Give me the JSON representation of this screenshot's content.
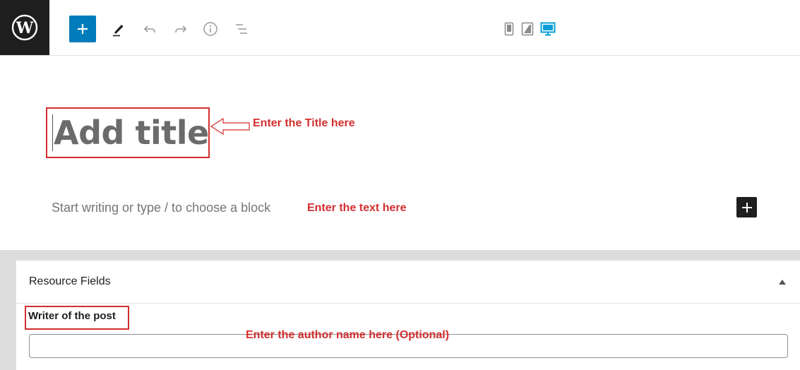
{
  "toolbar": {
    "logo_icon": "wordpress-icon",
    "add_block_icon": "plus-icon",
    "tools_icon": "pencil-icon",
    "undo_icon": "undo-icon",
    "redo_icon": "redo-icon",
    "info_icon": "info-icon",
    "outline_icon": "list-view-icon",
    "preview_devices": [
      "mobile-icon",
      "tablet-icon",
      "desktop-icon"
    ],
    "active_device": "desktop",
    "accent_color": "#007cba"
  },
  "editor": {
    "title_placeholder": "Add title",
    "body_placeholder": "Start writing or type / to choose a block",
    "inline_add_icon": "plus-icon"
  },
  "annotations": {
    "title": "Enter the Title here",
    "text": "Enter the text here",
    "author": "Enter the author name here (Optional)",
    "color": "#d32f2f"
  },
  "meta_box": {
    "title": "Resource Fields",
    "toggle_icon": "triangle-up-icon",
    "field_label": "Writer of the post",
    "field_value": ""
  }
}
